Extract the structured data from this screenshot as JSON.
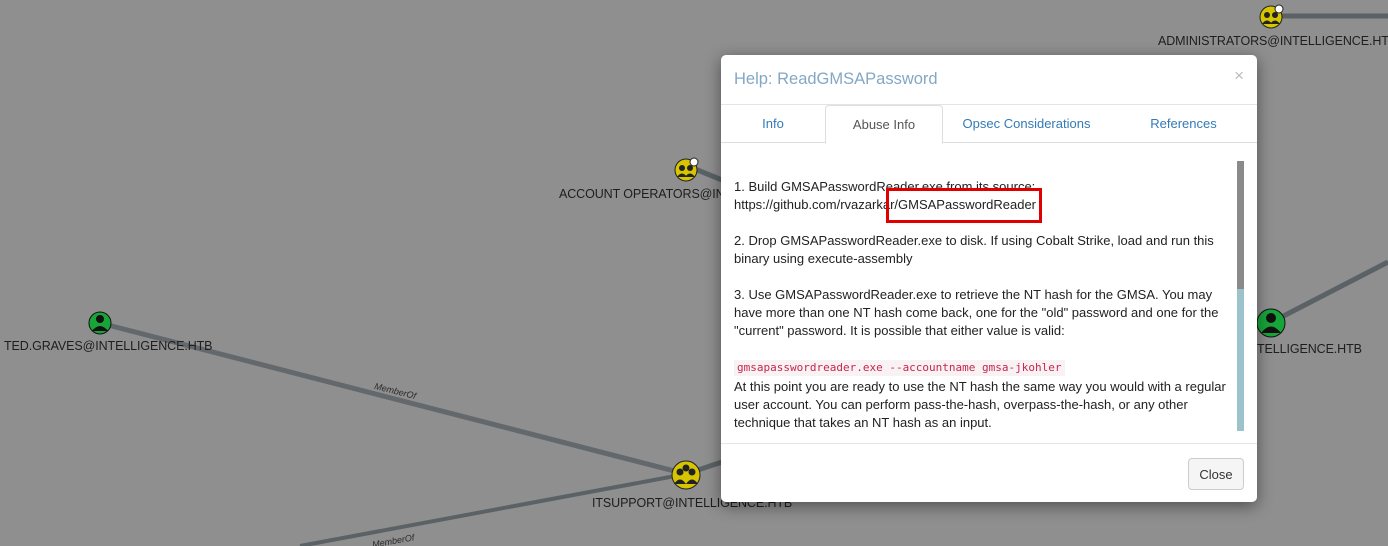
{
  "graph": {
    "nodes": [
      {
        "id": "administrators",
        "label": "ADMINISTRATORS@INTELLIGENCE.HTB",
        "type": "group"
      },
      {
        "id": "account-operators",
        "label": "ACCOUNT OPERATORS@INTE",
        "type": "group"
      },
      {
        "id": "ted-graves",
        "label": "TED.GRAVES@INTELLIGENCE.HTB",
        "type": "user"
      },
      {
        "id": "itsupport",
        "label": "ITSUPPORT@INTELLIGENCE.HTB",
        "type": "group"
      },
      {
        "id": "right-node",
        "label": "TELLIGENCE.HTB",
        "type": "user"
      }
    ],
    "edge_labels": [
      "MemberOf",
      "MemberOf"
    ],
    "colors": {
      "group_node": "#d6c500",
      "user_node": "#17a53a",
      "edge": "#5b6266"
    }
  },
  "modal": {
    "title": "Help: ReadGMSAPassword",
    "close_symbol": "×",
    "tabs": [
      {
        "label": "Info",
        "active": false
      },
      {
        "label": "Abuse Info",
        "active": true
      },
      {
        "label": "Opsec Considerations",
        "active": false
      },
      {
        "label": "References",
        "active": false
      }
    ],
    "body": {
      "step1": "1. Build GMSAPasswordReader.exe from its source:",
      "step1_url": "https://github.com/rvazarkar/GMSAPasswordReader",
      "step2": "2. Drop GMSAPasswordReader.exe to disk. If using Cobalt Strike, load and run this binary using execute-assembly",
      "step3": "3. Use GMSAPasswordReader.exe to retrieve the NT hash for the GMSA. You may have more than one NT hash come back, one for the \"old\" password and one for the \"current\" password. It is possible that either value is valid:",
      "command": "gmsapasswordreader.exe --accountname gmsa-jkohler",
      "after_command": "At this point you are ready to use the NT hash the same way you would with a regular user account. You can perform pass-the-hash, overpass-the-hash, or any other technique that takes an NT hash as an input."
    },
    "footer": {
      "close_label": "Close"
    },
    "highlight_color": "#e00000"
  }
}
